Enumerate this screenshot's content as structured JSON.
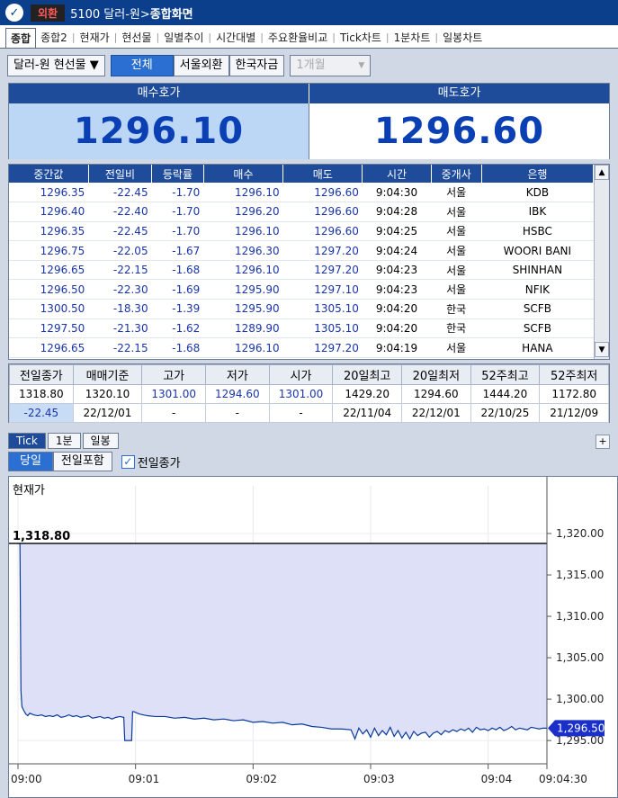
{
  "titlebar": {
    "badge": "외환",
    "screen_code": "5100 달러-원>",
    "screen_name": "종합화면"
  },
  "tabs": [
    {
      "label": "종합",
      "active": true
    },
    {
      "label": "종합2"
    },
    {
      "label": "현재가"
    },
    {
      "label": "현선물"
    },
    {
      "label": "일별추이"
    },
    {
      "label": "시간대별"
    },
    {
      "label": "주요환율비교"
    },
    {
      "label": "Tick차트"
    },
    {
      "label": "1분차트"
    },
    {
      "label": "일봉차트"
    }
  ],
  "toolbar": {
    "product_select": "달러-원 현선물",
    "filter_all": "전체",
    "filter_seoul": "서울외환",
    "filter_korea": "한국자금",
    "period_select": "1개월"
  },
  "quote": {
    "bid_label": "매수호가",
    "ask_label": "매도호가",
    "bid_value": "1296.10",
    "ask_value": "1296.60"
  },
  "tick_table": {
    "columns": [
      "중간값",
      "전일비",
      "등락률",
      "매수",
      "매도",
      "시간",
      "중개사",
      "은행"
    ],
    "rows": [
      [
        "1296.35",
        "-22.45",
        "-1.70",
        "1296.10",
        "1296.60",
        "9:04:30",
        "서울",
        "KDB"
      ],
      [
        "1296.40",
        "-22.40",
        "-1.70",
        "1296.20",
        "1296.60",
        "9:04:28",
        "서울",
        "IBK"
      ],
      [
        "1296.35",
        "-22.45",
        "-1.70",
        "1296.10",
        "1296.60",
        "9:04:25",
        "서울",
        "HSBC"
      ],
      [
        "1296.75",
        "-22.05",
        "-1.67",
        "1296.30",
        "1297.20",
        "9:04:24",
        "서울",
        "WOORI BANI"
      ],
      [
        "1296.65",
        "-22.15",
        "-1.68",
        "1296.10",
        "1297.20",
        "9:04:23",
        "서울",
        "SHINHAN"
      ],
      [
        "1296.50",
        "-22.30",
        "-1.69",
        "1295.90",
        "1297.10",
        "9:04:23",
        "서울",
        "NFIK"
      ],
      [
        "1300.50",
        "-18.30",
        "-1.39",
        "1295.90",
        "1305.10",
        "9:04:20",
        "한국",
        "SCFB"
      ],
      [
        "1297.50",
        "-21.30",
        "-1.62",
        "1289.90",
        "1305.10",
        "9:04:20",
        "한국",
        "SCFB"
      ],
      [
        "1296.65",
        "-22.15",
        "-1.68",
        "1296.10",
        "1297.20",
        "9:04:19",
        "서울",
        "HANA"
      ]
    ]
  },
  "summary": {
    "columns": [
      "전일종가",
      "매매기준",
      "고가",
      "저가",
      "시가",
      "20일최고",
      "20일최저",
      "52주최고",
      "52주최저"
    ],
    "row1": [
      "1318.80",
      "1320.10",
      "1301.00",
      "1294.60",
      "1301.00",
      "1429.20",
      "1294.60",
      "1444.20",
      "1172.80"
    ],
    "row2": [
      "-22.45",
      "22/12/01",
      "-",
      "-",
      "-",
      "22/11/04",
      "22/12/01",
      "22/10/25",
      "21/12/09"
    ]
  },
  "chart_tabs": {
    "tick": "Tick",
    "min1": "1분",
    "daily": "일봉",
    "plus": "+"
  },
  "chart_options": {
    "today": "당일",
    "include_prev": "전일포함",
    "prev_close_check": "✓",
    "prev_close_label": "전일종가"
  },
  "chart_data": {
    "type": "area",
    "series_label": "현재가",
    "prev_close_label": "1,318.80",
    "prev_close": 1318.8,
    "current_label": "1,296.50",
    "current": 1296.5,
    "y_ticks": [
      "1,320.00",
      "1,315.00",
      "1,310.00",
      "1,305.00",
      "1,300.00",
      "1,295.00"
    ],
    "y_tick_values": [
      1320,
      1315,
      1310,
      1305,
      1300,
      1295
    ],
    "ylim": [
      1292.3,
      1322.5
    ],
    "x_ticks": [
      "09:00",
      "09:01",
      "09:02",
      "09:03",
      "09:04",
      "09:04:30"
    ],
    "x_tick_values": [
      0,
      60,
      120,
      180,
      240,
      270
    ],
    "xlim": [
      0,
      270
    ],
    "x_unit": "seconds from 09:00",
    "x": [
      0,
      1,
      1.5,
      2,
      3,
      4,
      5,
      6,
      8,
      10,
      12,
      14,
      16,
      18,
      20,
      22,
      24,
      26,
      28,
      30,
      32,
      34,
      36,
      38,
      40,
      42,
      44,
      46,
      48,
      50,
      52,
      54,
      54.5,
      55,
      56,
      57,
      58,
      58.5,
      59,
      62,
      66,
      70,
      75,
      80,
      85,
      90,
      95,
      100,
      105,
      110,
      115,
      120,
      125,
      130,
      135,
      140,
      145,
      150,
      155,
      160,
      165,
      170,
      172,
      174,
      176,
      178,
      180,
      182,
      184,
      186,
      188,
      190,
      192,
      194,
      196,
      198,
      200,
      202,
      204,
      206,
      208,
      210,
      212,
      214,
      216,
      218,
      220,
      222,
      224,
      226,
      228,
      230,
      232,
      234,
      236,
      238,
      240,
      242,
      244,
      246,
      248,
      250,
      252,
      254,
      256,
      258,
      260,
      262,
      264,
      266,
      268,
      270
    ],
    "y": [
      1318.8,
      1318.8,
      1301.0,
      1299.1,
      1298.6,
      1298.2,
      1298.0,
      1298.3,
      1298.1,
      1298.0,
      1298.1,
      1297.9,
      1298.0,
      1297.9,
      1298.1,
      1297.8,
      1297.9,
      1298.1,
      1297.9,
      1298.0,
      1297.8,
      1297.9,
      1298.0,
      1297.7,
      1297.8,
      1297.9,
      1297.7,
      1297.8,
      1297.6,
      1297.8,
      1297.9,
      1297.8,
      1295.0,
      1295.0,
      1295.0,
      1295.0,
      1295.0,
      1298.5,
      1298.5,
      1298.2,
      1298.0,
      1297.9,
      1297.9,
      1297.7,
      1297.8,
      1297.6,
      1297.7,
      1297.5,
      1297.6,
      1297.4,
      1297.5,
      1297.2,
      1297.3,
      1297.1,
      1297.2,
      1296.9,
      1297.0,
      1296.7,
      1296.6,
      1296.4,
      1296.4,
      1296.3,
      1295.2,
      1296.5,
      1295.8,
      1296.3,
      1295.4,
      1296.5,
      1295.6,
      1296.2,
      1295.7,
      1296.6,
      1295.5,
      1296.2,
      1295.3,
      1296.0,
      1295.2,
      1296.1,
      1295.6,
      1295.9,
      1296.0,
      1295.4,
      1295.9,
      1296.1,
      1295.7,
      1296.2,
      1296.0,
      1296.3,
      1296.1,
      1296.4,
      1296.2,
      1296.5,
      1296.0,
      1296.6,
      1296.3,
      1296.4,
      1296.2,
      1296.5,
      1296.3,
      1296.6,
      1296.2,
      1296.4,
      1296.7,
      1296.3,
      1296.5,
      1296.4,
      1296.3,
      1296.6,
      1296.5,
      1296.4,
      1296.5,
      1296.5
    ],
    "colors": {
      "fill": "#dde0f7",
      "line": "#0a3a9a",
      "marker": "#1a30c8"
    }
  }
}
